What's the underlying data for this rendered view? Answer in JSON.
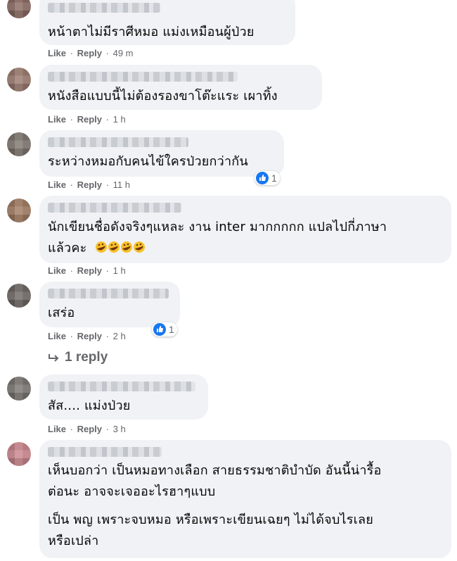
{
  "actions": {
    "like": "Like",
    "reply": "Reply",
    "dot": "·"
  },
  "comments": [
    {
      "text": "หน้าตาไม่มีราศีหมอ แม่งเหมือนผู้ป่วย",
      "time": "49 m"
    },
    {
      "text": "หนังสือแบบนี้ไม่ต้องรองขาโต๊ะแระ เผาทิ้ง",
      "time": "1 h"
    },
    {
      "text": "ระหว่างหมอกับคนไข้ใครป่วยกว่ากัน",
      "time": "11 h",
      "reaction_count": "1"
    },
    {
      "lines": [
        "นักเขียนชื่อดังจริงๆแหละ งาน inter มากกกกก แปลไปกี่ภาษา",
        "แล้วคะ"
      ],
      "time": "1 h",
      "emoji": [
        "rofl-emoji",
        "rofl-emoji",
        "rofl-emoji",
        "rofl-emoji"
      ]
    },
    {
      "text": "เสร่อ",
      "time": "2 h",
      "reaction_count": "1",
      "replies_label": "1 reply"
    },
    {
      "text": "สัส.... แม่งป่วย",
      "time": "3 h"
    },
    {
      "lines": [
        "เห็นบอกว่า เป็นหมอทางเลือก สายธรรมชาติบำบัด อันนี้น่ารื้อ",
        "ต่อนะ อาจจะเจออะไรฮาๆแบบ",
        "เป็น พญ เพราะจบหมอ หรือเพราะเขียนเฉยๆ ไม่ได้จบไรเลย",
        "หรือเปล่า"
      ]
    }
  ],
  "colors": {
    "bubble": "#f0f2f5",
    "meta": "#65676b",
    "like_blue": "#1877f2"
  },
  "icons": {
    "reaction": "like-icon",
    "reply_arrow": "reply-arrow-icon"
  }
}
